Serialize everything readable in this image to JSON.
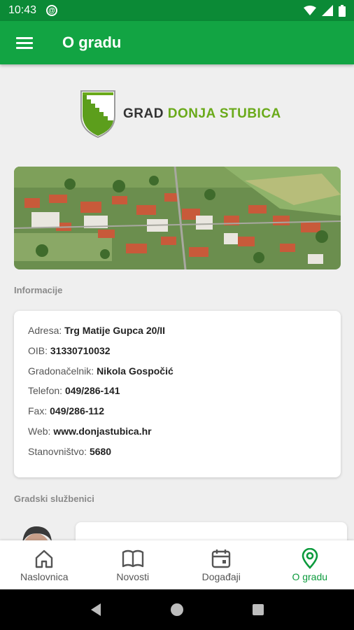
{
  "status_bar": {
    "time": "10:43",
    "icons": [
      "sync-icon",
      "wifi-icon",
      "signal-icon",
      "battery-icon"
    ]
  },
  "app_bar": {
    "title": "O gradu",
    "menu_icon": "hamburger-menu-icon"
  },
  "logo": {
    "text_part1": "GRAD",
    "text_part2": "DONJA STUBICA"
  },
  "sections": {
    "info_title": "Informacije",
    "staff_title": "Gradski službenici"
  },
  "info": [
    {
      "label": "Adresa:",
      "value": "Trg Matije Gupca 20/II"
    },
    {
      "label": "OIB:",
      "value": "31330710032"
    },
    {
      "label": "Gradonačelnik:",
      "value": "Nikola Gospočić"
    },
    {
      "label": "Telefon:",
      "value": "049/286-141"
    },
    {
      "label": "Fax:",
      "value": "049/286-112"
    },
    {
      "label": "Web:",
      "value": "www.donjastubica.hr"
    },
    {
      "label": "Stanovništvo:",
      "value": "5680"
    }
  ],
  "bottom_nav": [
    {
      "label": "Naslovnica",
      "icon": "home-icon"
    },
    {
      "label": "Novosti",
      "icon": "book-icon"
    },
    {
      "label": "Događaji",
      "icon": "calendar-icon"
    },
    {
      "label": "O gradu",
      "icon": "location-pin-icon",
      "active": true
    }
  ],
  "colors": {
    "status_bar": "#0b8a36",
    "app_bar": "#12a443",
    "accent": "#0b9a3c",
    "logo_green": "#6aaa1a"
  }
}
